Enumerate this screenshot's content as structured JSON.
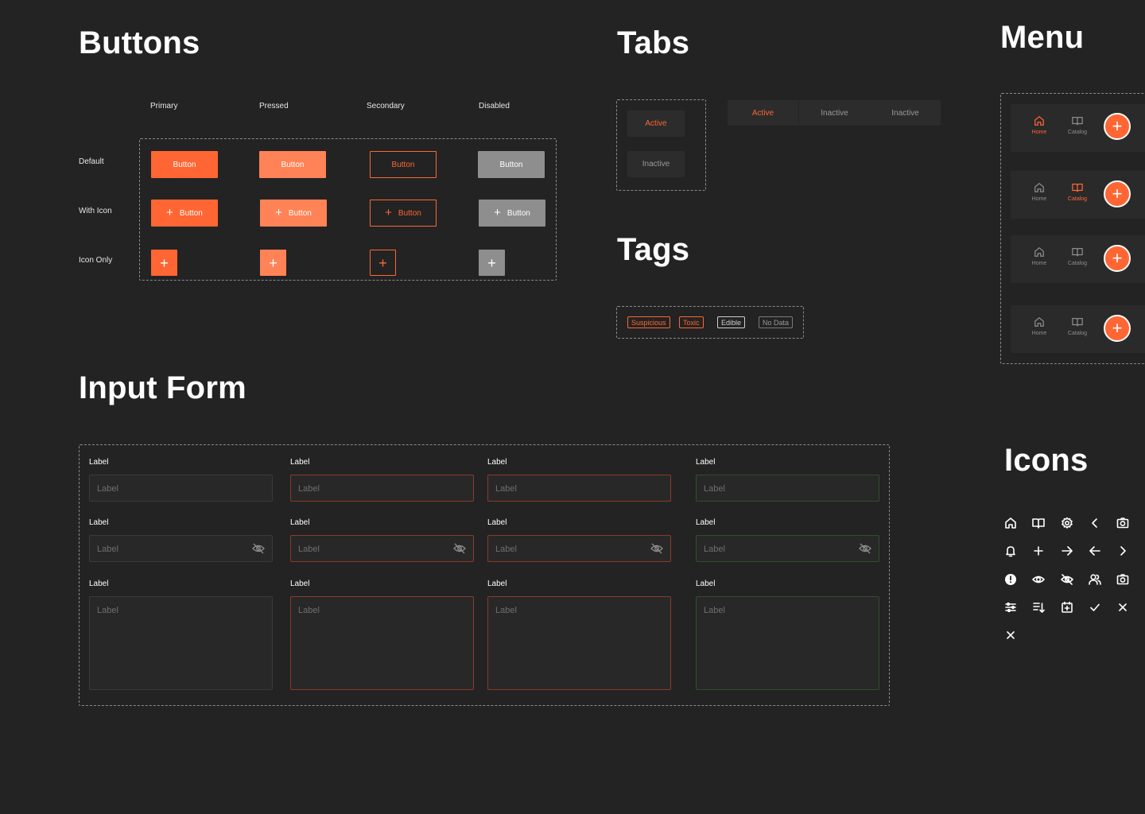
{
  "sections": {
    "buttons": "Buttons",
    "tabs": "Tabs",
    "menu": "Menu",
    "tags": "Tags",
    "input_form": "Input Form",
    "icons": "Icons"
  },
  "buttons": {
    "columns": [
      "Primary",
      "Pressed",
      "Secondary",
      "Disabled"
    ],
    "rows": [
      "Default",
      "With Icon",
      "Icon Only"
    ],
    "label": "Button",
    "plus": "+"
  },
  "tabs": {
    "vertical": [
      "Active",
      "Inactive"
    ],
    "horizontal": [
      "Active",
      "Inactive",
      "Inactive"
    ]
  },
  "tags": [
    "Suspicious",
    "Toxic",
    "Edible",
    "No Data"
  ],
  "menu": {
    "home": "Home",
    "catalog": "Catalog",
    "fab": "+"
  },
  "form": {
    "label": "Label",
    "placeholder": "Label"
  },
  "colors": {
    "accent": "#ff6633",
    "pressed": "#ff8356",
    "disabled": "#8e8e8e",
    "background": "#232323",
    "tag_edible": "#cfcfcf",
    "error_border": "#8a3a2a",
    "success_border": "#2f4d2f"
  },
  "icons": [
    "home-icon",
    "book-icon",
    "gear-icon",
    "chevron-left-icon",
    "camera-icon",
    "bell-icon",
    "plus-icon",
    "arrow-right-icon",
    "arrow-left-icon",
    "chevron-right-icon",
    "alert-icon",
    "eye-icon",
    "eye-off-icon",
    "users-icon",
    "camera-icon",
    "sliders-icon",
    "sort-icon",
    "calendar-add-icon",
    "check-icon",
    "close-icon",
    "close-icon"
  ]
}
